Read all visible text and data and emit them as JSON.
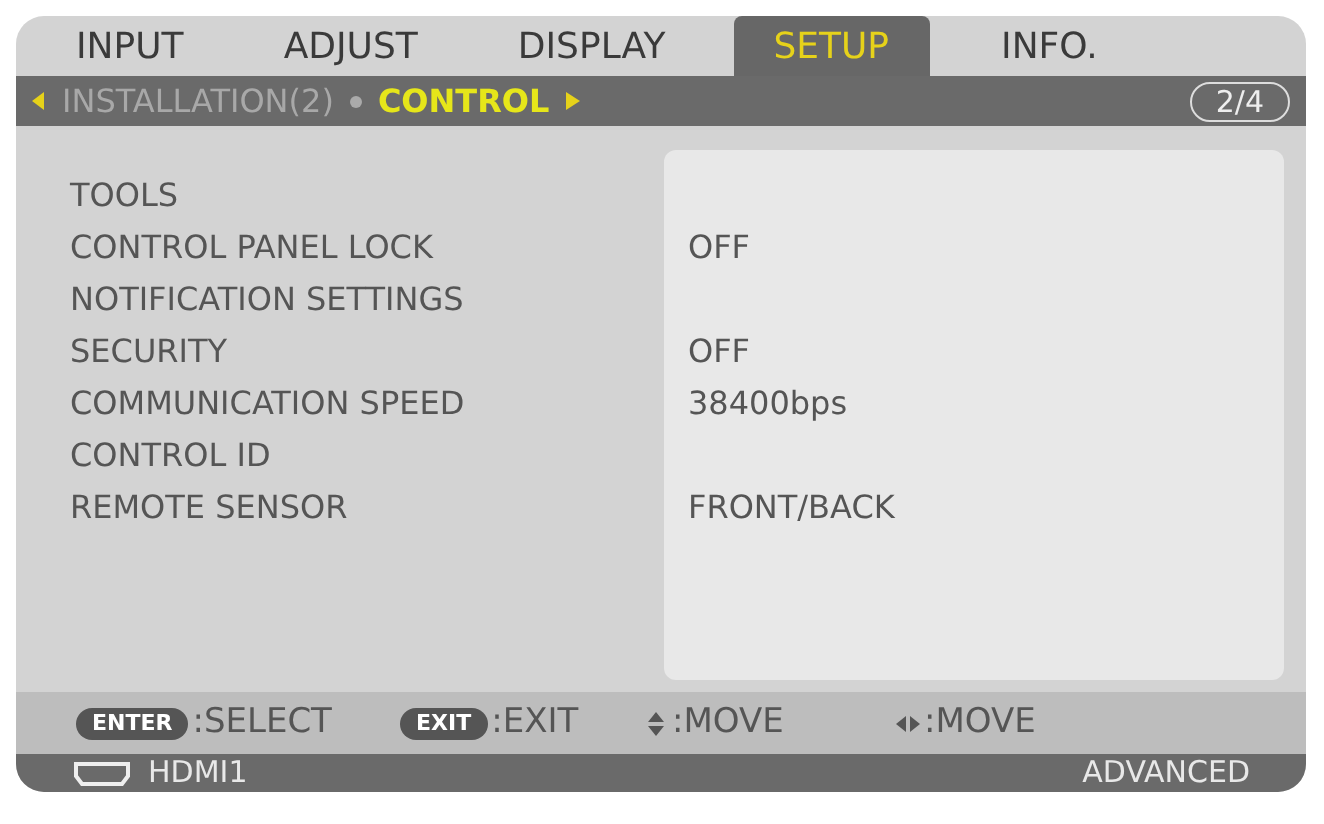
{
  "tabs": [
    {
      "label": "INPUT",
      "selected": false
    },
    {
      "label": "ADJUST",
      "selected": false
    },
    {
      "label": "DISPLAY",
      "selected": false
    },
    {
      "label": "SETUP",
      "selected": true
    },
    {
      "label": "INFO.",
      "selected": false
    }
  ],
  "subpages": [
    {
      "label": "INSTALLATION(2)",
      "selected": false
    },
    {
      "label": "CONTROL",
      "selected": true
    }
  ],
  "page_indicator": "2/4",
  "items": [
    {
      "label": "TOOLS"
    },
    {
      "label": "CONTROL PANEL LOCK",
      "value": "OFF"
    },
    {
      "label": "NOTIFICATION SETTINGS"
    },
    {
      "label": "SECURITY",
      "value": "OFF"
    },
    {
      "label": "COMMUNICATION SPEED",
      "value": "38400bps"
    },
    {
      "label": "CONTROL ID"
    },
    {
      "label": "REMOTE SENSOR",
      "value": "FRONT/BACK"
    }
  ],
  "hints": [
    {
      "kind": "key",
      "key": "ENTER",
      "text": ":SELECT"
    },
    {
      "kind": "key",
      "key": "EXIT",
      "text": ":EXIT"
    },
    {
      "kind": "updown",
      "text": ":MOVE"
    },
    {
      "kind": "leftright",
      "text": ":MOVE"
    }
  ],
  "status_bar": {
    "source": "HDMI1",
    "mode": "ADVANCED"
  }
}
